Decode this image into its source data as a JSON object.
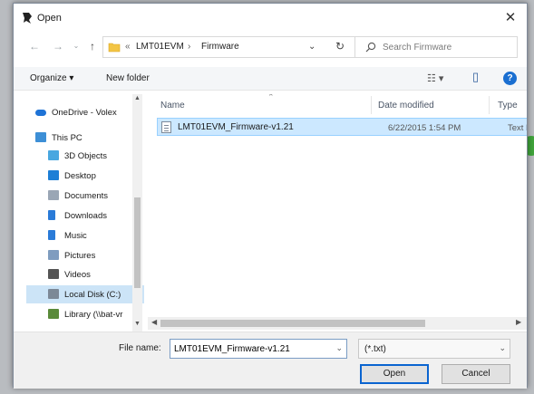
{
  "window": {
    "title": "Open",
    "close_glyph": "✕"
  },
  "address": {
    "prefix": "«",
    "path": [
      "LMT01EVM",
      "Firmware"
    ],
    "separator": "›",
    "dropdown_glyph": "⌄",
    "refresh_glyph": "↻"
  },
  "search": {
    "placeholder": "Search Firmware"
  },
  "toolbar": {
    "organize": "Organize ▾",
    "new_folder": "New folder",
    "view_icon": "☷ ▾",
    "pane_icon": "▯",
    "help": "?"
  },
  "nav": {
    "items": [
      {
        "label": "OneDrive - Volex",
        "icon": "onedrive-icon",
        "color": "#1e73d6"
      },
      {
        "label": "This PC",
        "icon": "computer-icon",
        "color": "#3d8fd6"
      },
      {
        "label": "3D Objects",
        "icon": "cube-icon",
        "color": "#49a7e0"
      },
      {
        "label": "Desktop",
        "icon": "desktop-icon",
        "color": "#1d7fd6"
      },
      {
        "label": "Documents",
        "icon": "documents-icon",
        "color": "#9aa6b5"
      },
      {
        "label": "Downloads",
        "icon": "download-icon",
        "color": "#2a7bd8"
      },
      {
        "label": "Music",
        "icon": "music-icon",
        "color": "#2a7bd8"
      },
      {
        "label": "Pictures",
        "icon": "pictures-icon",
        "color": "#7f9cbf"
      },
      {
        "label": "Videos",
        "icon": "videos-icon",
        "color": "#555555"
      },
      {
        "label": "Local Disk (C:)",
        "icon": "disk-icon",
        "color": "#7c8896"
      },
      {
        "label": "Library (\\\\bat-vr",
        "icon": "network-drive-icon",
        "color": "#5a8a3a"
      }
    ],
    "selected_index": 9
  },
  "columns": {
    "name": "Name",
    "date": "Date modified",
    "type": "Type"
  },
  "files": [
    {
      "name": "LMT01EVM_Firmware-v1.21",
      "date": "6/22/2015 1:54 PM",
      "type": "Text Do"
    }
  ],
  "bottom": {
    "file_name_label": "File name:",
    "file_name_value": "LMT01EVM_Firmware-v1.21",
    "file_type": "(*.txt)",
    "open": "Open",
    "cancel": "Cancel"
  },
  "colors": {
    "selection": "#cce8ff",
    "accent": "#0a64d0",
    "help": "#1a6fd1"
  }
}
